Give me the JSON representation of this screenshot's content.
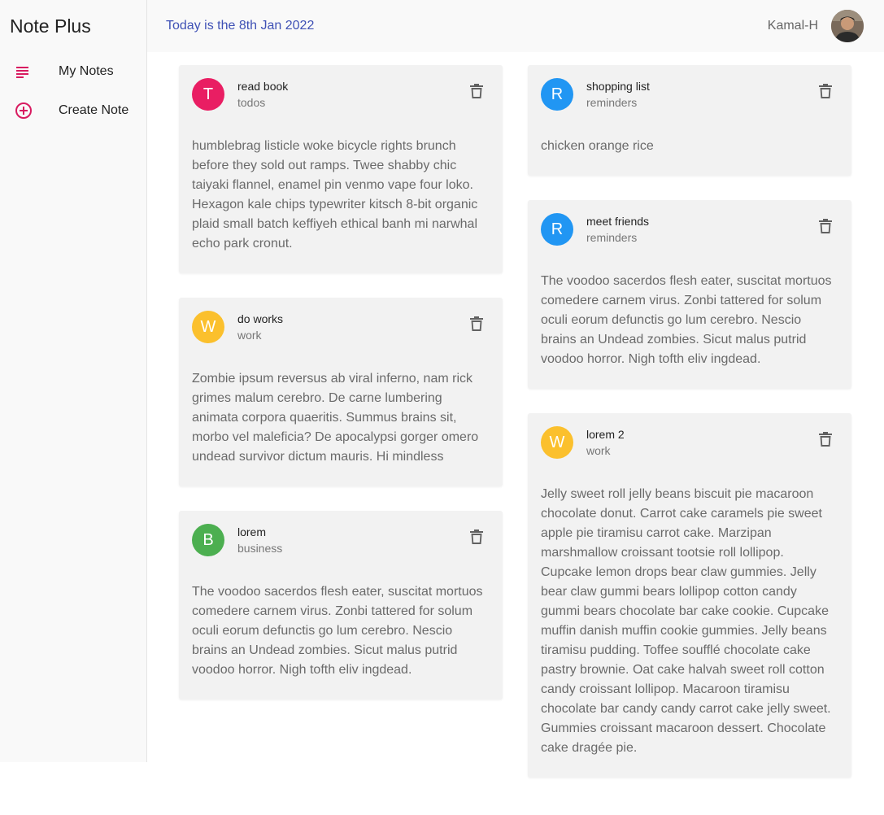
{
  "app": {
    "title": "Note Plus"
  },
  "sidebar": {
    "items": [
      {
        "label": "My Notes",
        "icon": "notes-list-icon"
      },
      {
        "label": "Create Note",
        "icon": "add-circle-icon"
      }
    ]
  },
  "header": {
    "date_text": "Today is the 8th Jan 2022",
    "username": "Kamal-H"
  },
  "colors": {
    "todos": "#e91e63",
    "reminders": "#2196f3",
    "work": "#fbc02d",
    "business": "#4caf50",
    "accent": "#d81b60",
    "date_text": "#3f51b5"
  },
  "notes": {
    "left": [
      {
        "initial": "T",
        "title": "read book",
        "category": "todos",
        "body": "humblebrag listicle woke bicycle rights brunch before they sold out ramps. Twee shabby chic taiyaki flannel, enamel pin venmo vape four loko. Hexagon kale chips typewriter kitsch 8-bit organic plaid small batch keffiyeh ethical banh mi narwhal echo park cronut."
      },
      {
        "initial": "W",
        "title": "do works",
        "category": "work",
        "body": "Zombie ipsum reversus ab viral inferno, nam rick grimes malum cerebro. De carne lumbering animata corpora quaeritis. Summus brains sit, morbo vel maleficia? De apocalypsi gorger omero undead survivor dictum mauris. Hi mindless"
      },
      {
        "initial": "B",
        "title": "lorem",
        "category": "business",
        "body": "The voodoo sacerdos flesh eater, suscitat mortuos comedere carnem virus. Zonbi tattered for solum oculi eorum defunctis go lum cerebro. Nescio brains an Undead zombies. Sicut malus putrid voodoo horror. Nigh tofth eliv ingdead."
      }
    ],
    "right": [
      {
        "initial": "R",
        "title": "shopping list",
        "category": "reminders",
        "body": "chicken orange rice"
      },
      {
        "initial": "R",
        "title": "meet friends",
        "category": "reminders",
        "body": "The voodoo sacerdos flesh eater, suscitat mortuos comedere carnem virus. Zonbi tattered for solum oculi eorum defunctis go lum cerebro. Nescio brains an Undead zombies. Sicut malus putrid voodoo horror. Nigh tofth eliv ingdead."
      },
      {
        "initial": "W",
        "title": "lorem 2",
        "category": "work",
        "body": "Jelly sweet roll jelly beans biscuit pie macaroon chocolate donut. Carrot cake caramels pie sweet apple pie tiramisu carrot cake. Marzipan marshmallow croissant tootsie roll lollipop. Cupcake lemon drops bear claw gummies. Jelly bear claw gummi bears lollipop cotton candy gummi bears chocolate bar cake cookie. Cupcake muffin danish muffin cookie gummies. Jelly beans tiramisu pudding. Toffee soufflé chocolate cake pastry brownie. Oat cake halvah sweet roll cotton candy croissant lollipop. Macaroon tiramisu chocolate bar candy candy carrot cake jelly sweet. Gummies croissant macaroon dessert. Chocolate cake dragée pie."
      }
    ]
  }
}
